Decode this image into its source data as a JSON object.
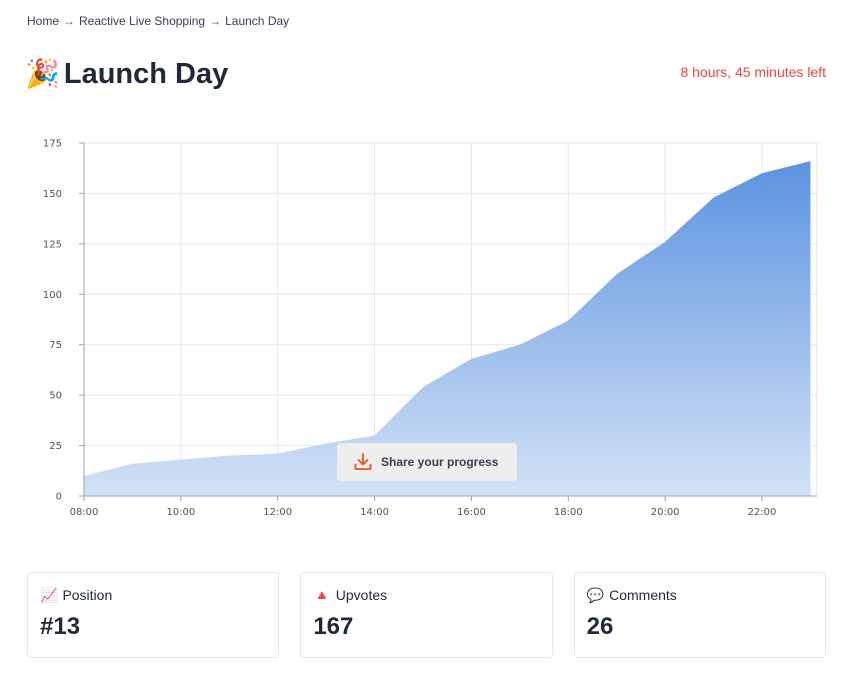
{
  "breadcrumb": {
    "items": [
      "Home",
      "Reactive Live Shopping",
      "Launch Day"
    ],
    "separator": "→"
  },
  "header": {
    "emoji": "🎉",
    "title": "Launch Day",
    "time_left": "8 hours, 45 minutes left"
  },
  "share_button": {
    "label": "Share your progress",
    "icon": "download-icon",
    "icon_color": "#e8541c"
  },
  "chart_data": {
    "type": "area",
    "x": [
      "08:00",
      "09:00",
      "10:00",
      "11:00",
      "12:00",
      "13:00",
      "14:00",
      "15:00",
      "16:00",
      "17:00",
      "18:00",
      "19:00",
      "20:00",
      "21:00",
      "22:00",
      "23:00"
    ],
    "values": [
      10,
      16,
      18,
      20,
      21,
      26,
      30,
      54,
      68,
      75,
      87,
      110,
      126,
      148,
      160,
      166
    ],
    "x_ticks": [
      "08:00",
      "10:00",
      "12:00",
      "14:00",
      "16:00",
      "18:00",
      "20:00",
      "22:00"
    ],
    "y_ticks": [
      0,
      25,
      50,
      75,
      100,
      125,
      150,
      175
    ],
    "ylim": [
      0,
      175
    ],
    "grid": true,
    "fill_top_color": "#5b93e0",
    "fill_bottom_color": "#d3e2f6"
  },
  "stats": [
    {
      "icon": "📈",
      "icon_name": "chart-increasing-icon",
      "label": "Position",
      "value": "#13"
    },
    {
      "icon": "🔺",
      "icon_name": "red-triangle-icon",
      "label": "Upvotes",
      "value": "167"
    },
    {
      "icon": "💬",
      "icon_name": "speech-balloon-icon",
      "label": "Comments",
      "value": "26"
    }
  ]
}
